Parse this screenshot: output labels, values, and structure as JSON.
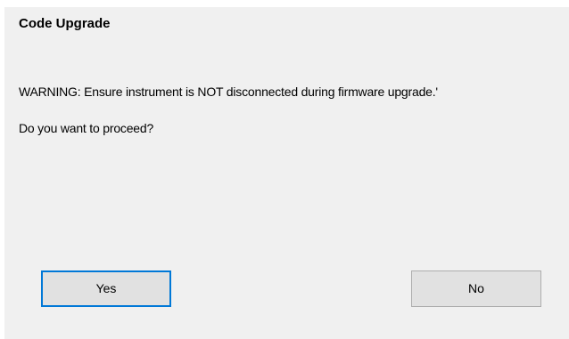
{
  "dialog": {
    "title": "Code Upgrade",
    "warning_text": "WARNING: Ensure instrument is NOT disconnected during firmware upgrade.'",
    "question_text": "Do you want to proceed?",
    "yes_label": "Yes",
    "no_label": "No",
    "focus_color": "#0078d7",
    "background_color": "#f0f0f0"
  }
}
